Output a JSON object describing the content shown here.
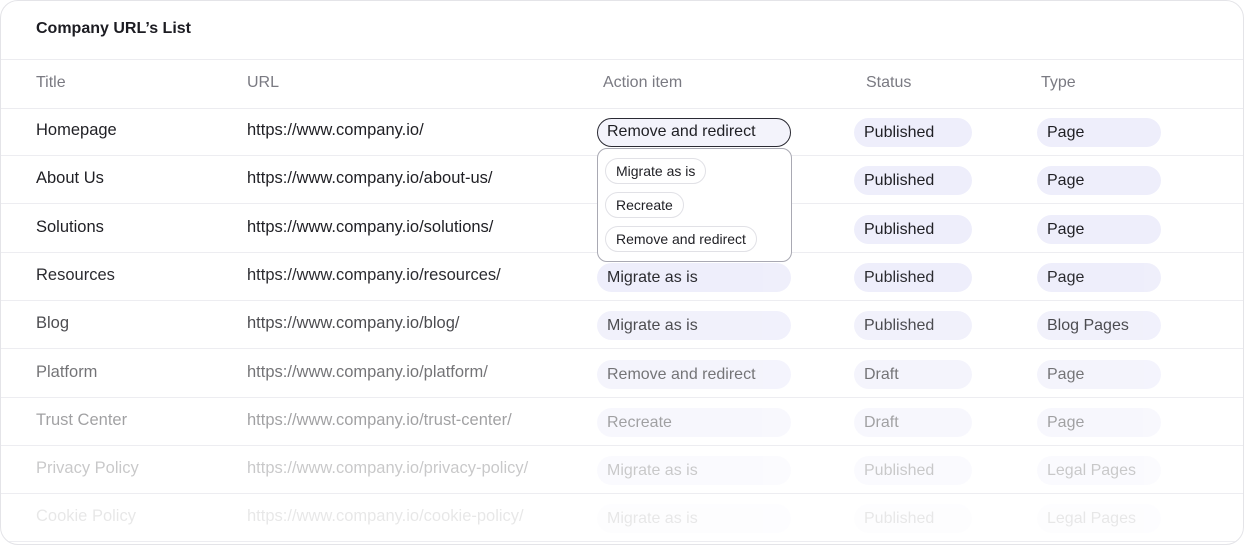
{
  "card": {
    "title": "Company URL’s List"
  },
  "columns": {
    "title": "Title",
    "url": "URL",
    "action": "Action item",
    "status": "Status",
    "type": "Type"
  },
  "rows": [
    {
      "title": "Homepage",
      "url": "https://www.company.io/",
      "action": "Remove and redirect",
      "status": "Published",
      "type": "Page"
    },
    {
      "title": "About Us",
      "url": "https://www.company.io/about-us/",
      "action": "",
      "status": "Published",
      "type": "Page"
    },
    {
      "title": "Solutions",
      "url": "https://www.company.io/solutions/",
      "action": "",
      "status": "Published",
      "type": "Page"
    },
    {
      "title": "Resources",
      "url": "https://www.company.io/resources/",
      "action": "Migrate as is",
      "status": "Published",
      "type": "Page"
    },
    {
      "title": "Blog",
      "url": "https://www.company.io/blog/",
      "action": "Migrate as is",
      "status": "Published",
      "type": "Blog Pages"
    },
    {
      "title": "Platform",
      "url": "https://www.company.io/platform/",
      "action": "Remove and redirect",
      "status": "Draft",
      "type": "Page"
    },
    {
      "title": "Trust Center",
      "url": "https://www.company.io/trust-center/",
      "action": "Recreate",
      "status": "Draft",
      "type": "Page"
    },
    {
      "title": "Privacy Policy",
      "url": "https://www.company.io/privacy-policy/",
      "action": "Migrate as is",
      "status": "Published",
      "type": "Legal Pages"
    },
    {
      "title": "Cookie Policy",
      "url": "https://www.company.io/cookie-policy/",
      "action": "Migrate as is",
      "status": "Published",
      "type": "Legal Pages"
    }
  ],
  "dropdown": {
    "options": [
      "Migrate as is",
      "Recreate",
      "Remove and redirect"
    ]
  }
}
